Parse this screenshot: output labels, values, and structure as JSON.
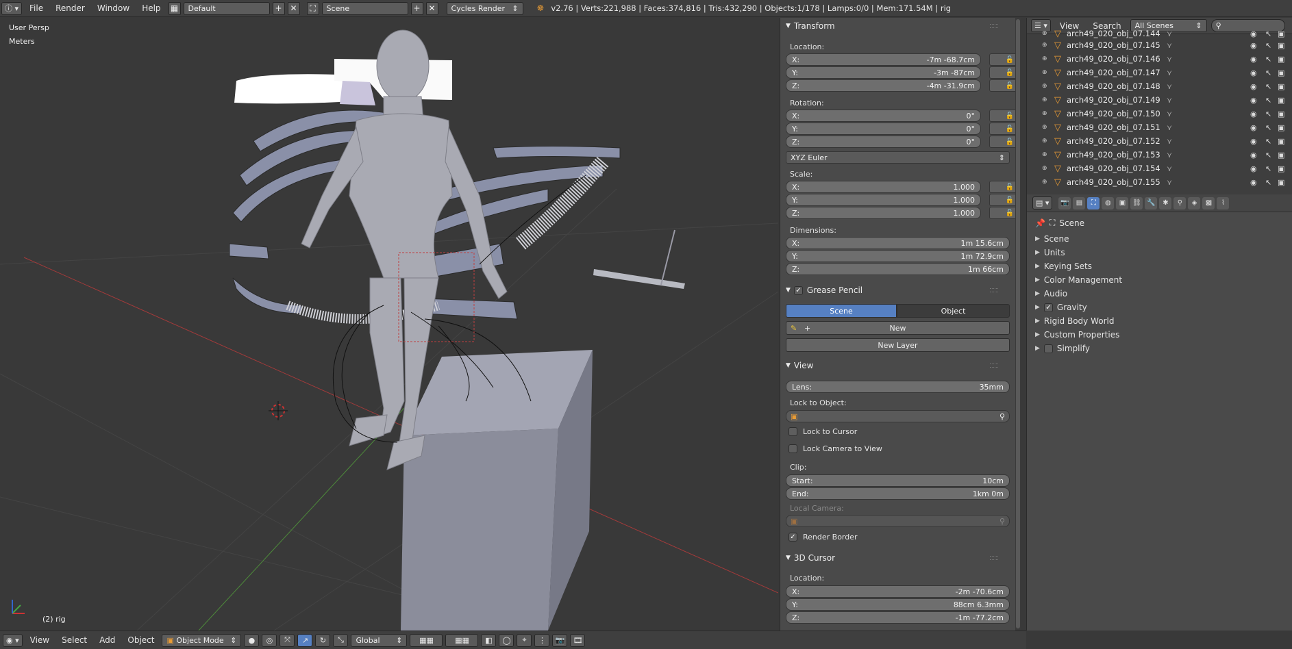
{
  "topbar": {
    "menus": [
      "File",
      "Render",
      "Window",
      "Help"
    ],
    "screen_layout": "Default",
    "scene": "Scene",
    "render_engine": "Cycles Render",
    "stats": "v2.76 | Verts:221,988 | Faces:374,816 | Tris:432,290 | Objects:1/178 | Lamps:0/0 | Mem:171.54M | rig"
  },
  "viewport": {
    "view_name": "User Persp",
    "units": "Meters",
    "object_label": "(2) rig"
  },
  "transform": {
    "title": "Transform",
    "location_label": "Location:",
    "location": [
      {
        "k": "X:",
        "v": "-7m -68.7cm"
      },
      {
        "k": "Y:",
        "v": "-3m -87cm"
      },
      {
        "k": "Z:",
        "v": "-4m -31.9cm"
      }
    ],
    "rotation_label": "Rotation:",
    "rotation": [
      {
        "k": "X:",
        "v": "0°"
      },
      {
        "k": "Y:",
        "v": "0°"
      },
      {
        "k": "Z:",
        "v": "0°"
      }
    ],
    "rotation_mode": "XYZ Euler",
    "scale_label": "Scale:",
    "scale": [
      {
        "k": "X:",
        "v": "1.000"
      },
      {
        "k": "Y:",
        "v": "1.000"
      },
      {
        "k": "Z:",
        "v": "1.000"
      }
    ],
    "dimensions_label": "Dimensions:",
    "dimensions": [
      {
        "k": "X:",
        "v": "1m 15.6cm"
      },
      {
        "k": "Y:",
        "v": "1m 72.9cm"
      },
      {
        "k": "Z:",
        "v": "1m 66cm"
      }
    ]
  },
  "grease_pencil": {
    "title": "Grease Pencil",
    "scene_tab": "Scene",
    "object_tab": "Object",
    "new_label": "New",
    "new_layer_label": "New Layer"
  },
  "view_panel": {
    "title": "View",
    "lens_label": "Lens:",
    "lens_value": "35mm",
    "lock_to_object": "Lock to Object:",
    "lock_to_cursor": "Lock to Cursor",
    "lock_camera": "Lock Camera to View",
    "clip_label": "Clip:",
    "clip_start_k": "Start:",
    "clip_start_v": "10cm",
    "clip_end_k": "End:",
    "clip_end_v": "1km 0m",
    "local_camera": "Local Camera:",
    "render_border": "Render Border"
  },
  "cursor3d": {
    "title": "3D Cursor",
    "location_label": "Location:",
    "location": [
      {
        "k": "X:",
        "v": "-2m -70.6cm"
      },
      {
        "k": "Y:",
        "v": "88cm 6.3mm"
      },
      {
        "k": "Z:",
        "v": "-1m -77.2cm"
      }
    ]
  },
  "outliner": {
    "view_menu": "View",
    "search_menu": "Search",
    "display_mode": "All Scenes",
    "partial_top": "arch49_020_obj_07.144",
    "rows": [
      "arch49_020_obj_07.145",
      "arch49_020_obj_07.146",
      "arch49_020_obj_07.147",
      "arch49_020_obj_07.148",
      "arch49_020_obj_07.149",
      "arch49_020_obj_07.150",
      "arch49_020_obj_07.151",
      "arch49_020_obj_07.152",
      "arch49_020_obj_07.153",
      "arch49_020_obj_07.154",
      "arch49_020_obj_07.155"
    ]
  },
  "properties": {
    "context": "Scene",
    "sections": [
      "Scene",
      "Units",
      "Keying Sets",
      "Color Management",
      "Audio",
      "Gravity",
      "Rigid Body World",
      "Custom Properties",
      "Simplify"
    ]
  },
  "bottombar": {
    "menus": [
      "View",
      "Select",
      "Add",
      "Object"
    ],
    "mode": "Object Mode",
    "orientation": "Global"
  }
}
